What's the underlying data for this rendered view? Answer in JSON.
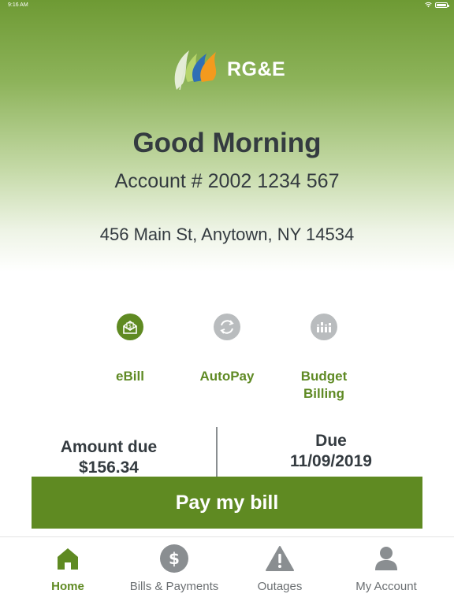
{
  "status_bar": {
    "time": "9:16 AM"
  },
  "brand": {
    "name": "RG&E"
  },
  "header": {
    "greeting": "Good Morning",
    "account": "Account # 2002 1234 567",
    "address": "456 Main St, Anytown, NY 14534"
  },
  "features": [
    {
      "label": "eBill",
      "icon": "ebill-envelope-icon",
      "active": true
    },
    {
      "label": "AutoPay",
      "icon": "autopay-cycle-icon",
      "active": false
    },
    {
      "label_line1": "Budget",
      "label_line2": "Billing",
      "icon": "budget-billing-icon",
      "active": false
    }
  ],
  "summary": {
    "amount_label": "Amount due",
    "amount_value": "$156.34",
    "due_label": "Due",
    "due_value": "11/09/2019"
  },
  "pay_button": {
    "label": "Pay my bill"
  },
  "tabs": [
    {
      "label": "Home",
      "icon": "home-icon",
      "active": true
    },
    {
      "label": "Bills & Payments",
      "icon": "dollar-icon",
      "active": false
    },
    {
      "label": "Outages",
      "icon": "warning-icon",
      "active": false
    },
    {
      "label": "My Account",
      "icon": "user-icon",
      "active": false
    }
  ],
  "colors": {
    "brand_green": "#5f8a22",
    "text_dark": "#343b40",
    "inactive_gray": "#8a8e91"
  }
}
